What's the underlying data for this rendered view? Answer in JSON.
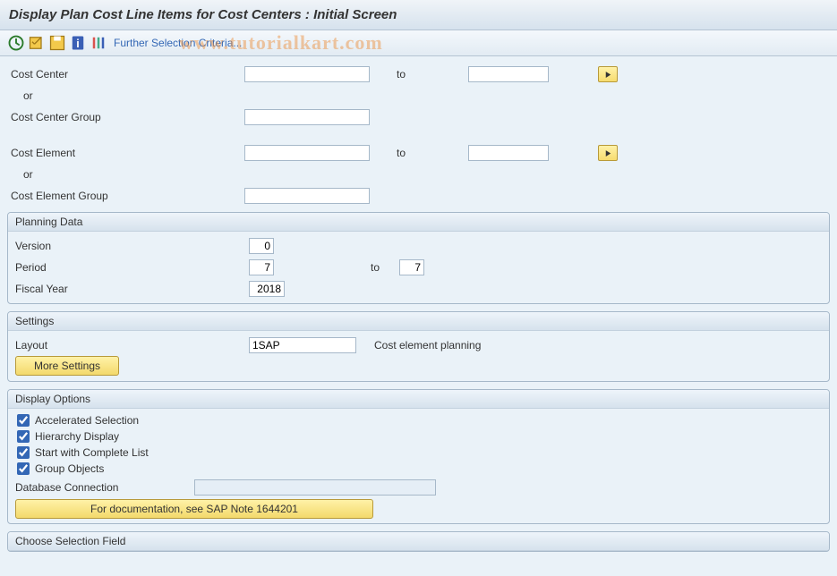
{
  "title": "Display Plan Cost Line Items for Cost Centers : Initial Screen",
  "watermark": "www.tutorialkart.com",
  "toolbar": {
    "further_criteria": "Further Selection Criteria..."
  },
  "selection": {
    "cost_center_lbl": "Cost Center",
    "cost_center_val": "",
    "to_lbl": "to",
    "cost_center_to_val": "",
    "or_lbl": "or",
    "cost_center_group_lbl": "Cost Center Group",
    "cost_center_group_val": "",
    "cost_element_lbl": "Cost Element",
    "cost_element_val": "",
    "cost_element_to_val": "",
    "cost_element_group_lbl": "Cost Element Group",
    "cost_element_group_val": ""
  },
  "planning": {
    "hdr": "Planning Data",
    "version_lbl": "Version",
    "version_val": "0",
    "period_lbl": "Period",
    "period_from": "7",
    "period_to": "7",
    "fy_lbl": "Fiscal Year",
    "fy_val": "2018"
  },
  "settings": {
    "hdr": "Settings",
    "layout_lbl": "Layout",
    "layout_val": "1SAP",
    "layout_desc": "Cost element planning",
    "more_btn": "More Settings"
  },
  "display": {
    "hdr": "Display Options",
    "accel": "Accelerated Selection",
    "hier": "Hierarchy Display",
    "start_complete": "Start with Complete List",
    "group_obj": "Group Objects",
    "db_conn_lbl": "Database Connection",
    "db_conn_val": "",
    "doc_btn": "For documentation, see SAP Note 1644201"
  },
  "choose_field": {
    "hdr": "Choose Selection Field"
  }
}
